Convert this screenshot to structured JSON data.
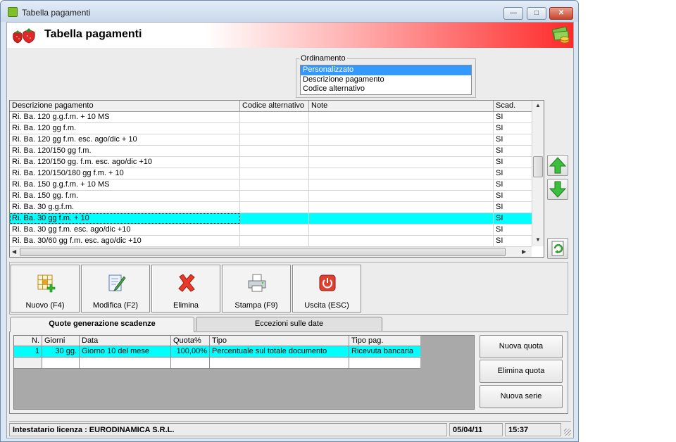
{
  "window": {
    "title": "Tabella pagamenti"
  },
  "header": {
    "title": "Tabella pagamenti"
  },
  "ordinamento": {
    "legend": "Ordinamento",
    "options": [
      "Personalizzato",
      "Descrizione pagamento",
      "Codice alternativo"
    ],
    "selected_index": 0
  },
  "grid": {
    "columns": [
      "Descrizione pagamento",
      "Codice alternativo",
      "Note",
      "Scad."
    ],
    "rows": [
      [
        "Ri. Ba. 120 g.g.f.m. + 10 MS",
        "",
        "",
        "SI"
      ],
      [
        "Ri. Ba. 120 gg f.m.",
        "",
        "",
        "SI"
      ],
      [
        "Ri. Ba. 120 gg f.m. esc. ago/dic + 10",
        "",
        "",
        "SI"
      ],
      [
        "Ri. Ba. 120/150 gg f.m.",
        "",
        "",
        "SI"
      ],
      [
        "Ri. Ba. 120/150 gg. f.m. esc. ago/dic +10",
        "",
        "",
        "SI"
      ],
      [
        "Ri. Ba. 120/150/180 gg f.m. + 10",
        "",
        "",
        "SI"
      ],
      [
        "Ri. Ba. 150 g.g.f.m. + 10 MS",
        "",
        "",
        "SI"
      ],
      [
        "Ri. Ba. 150 gg. f.m.",
        "",
        "",
        "SI"
      ],
      [
        "Ri. Ba. 30 g.g.f.m.",
        "",
        "",
        "SI"
      ],
      [
        "Ri. Ba. 30 gg f.m. + 10",
        "",
        "",
        "SI"
      ],
      [
        "Ri. Ba. 30 gg f.m. esc. ago/dic +10",
        "",
        "",
        "SI"
      ],
      [
        "Ri. Ba. 30/60 gg f.m. esc. ago/dic +10",
        "",
        "",
        "SI"
      ]
    ],
    "selected_row": 9
  },
  "toolbar": {
    "nuovo": "Nuovo (F4)",
    "modifica": "Modifica (F2)",
    "elimina": "Elimina",
    "stampa": "Stampa (F9)",
    "uscita": "Uscita (ESC)"
  },
  "tabs": {
    "quote": "Quote generazione scadenze",
    "eccezioni": "Eccezioni sulle date"
  },
  "quote_grid": {
    "columns": [
      "N.",
      "Giorni",
      "Data",
      "Quota%",
      "Tipo",
      "Tipo pag."
    ],
    "rows": [
      [
        "1",
        "30 gg.",
        "Giorno 10 del mese",
        "100,00%",
        "Percentuale sul totale documento",
        "Ricevuta bancaria"
      ]
    ]
  },
  "quote_buttons": {
    "nuova_quota": "Nuova quota",
    "elimina_quota": "Elimina quota",
    "nuova_serie": "Nuova serie"
  },
  "status": {
    "license": "Intestatario licenza : EURODINAMICA S.R.L.",
    "date": "05/04/11",
    "time": "15:37"
  },
  "colors": {
    "selection": "#00ffff",
    "list_selection": "#3399ff",
    "header_red": "#ff2a2a"
  }
}
